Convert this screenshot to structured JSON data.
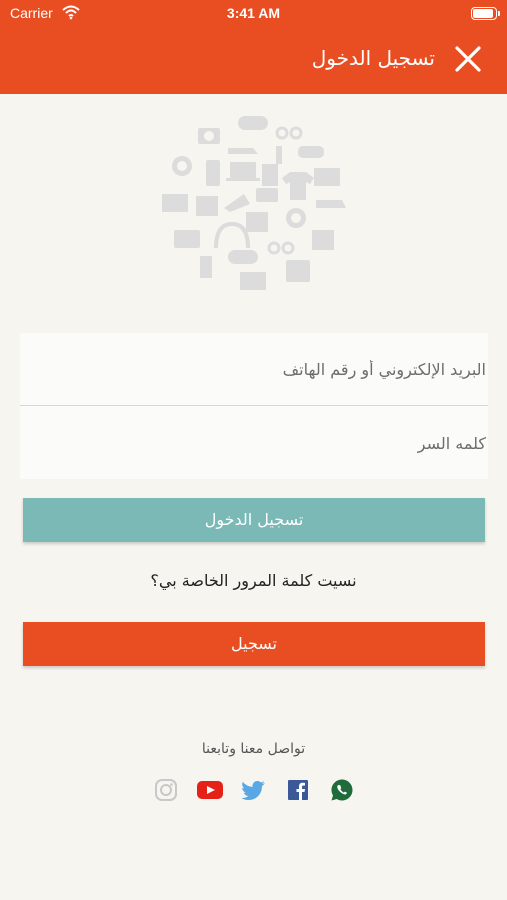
{
  "status_bar": {
    "carrier": "Carrier",
    "time": "3:41 AM"
  },
  "header": {
    "title": "تسجيل الدخول",
    "close_icon": "close-icon"
  },
  "hero": {
    "icon": "shopping-categories-illustration"
  },
  "form": {
    "email_placeholder": "البريد الإلكتروني أو رقم الهاتف",
    "email_value": "",
    "password_placeholder": "كلمه السر",
    "password_value": ""
  },
  "actions": {
    "login_label": "تسجيل الدخول",
    "forgot_label": "نسيت كلمة المرور الخاصة بي؟",
    "register_label": "تسجيل"
  },
  "social": {
    "heading": "تواصل معنا وتابعنا",
    "links": [
      {
        "name": "instagram",
        "icon": "instagram-icon",
        "color": "#c8c8c8"
      },
      {
        "name": "youtube",
        "icon": "youtube-icon",
        "color": "#e62117"
      },
      {
        "name": "twitter",
        "icon": "twitter-icon",
        "color": "#5aa7e6"
      },
      {
        "name": "facebook",
        "icon": "facebook-icon",
        "color": "#3b5998"
      },
      {
        "name": "whatsapp",
        "icon": "whatsapp-icon",
        "color": "#1f6b3a"
      }
    ]
  },
  "colors": {
    "brand": "#e94e23",
    "login_button": "#7ab9b6",
    "background": "#f6f5f0"
  }
}
